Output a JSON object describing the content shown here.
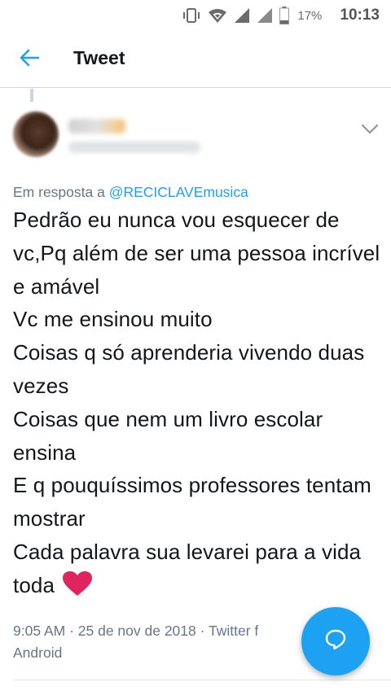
{
  "status_bar": {
    "battery_percent": "17%",
    "time": "10:13",
    "icons": [
      "vibrate-icon",
      "wifi-icon",
      "signal-icon",
      "signal-icon-2",
      "battery-icon"
    ]
  },
  "app_bar": {
    "title": "Tweet",
    "back_icon": "arrow-left-icon"
  },
  "tweet": {
    "author_name": "",
    "author_handle": "",
    "reply_prefix": "Em resposta a ",
    "reply_to": "@RECICLAVEmusica",
    "text": "Pedrão eu nunca vou esquecer de vc,Pq além de ser uma pessoa incrível e amável\nVc me ensinou muito\nCoisas q só aprenderia vivendo duas vezes\nCoisas que nem um livro escolar ensina\nE q pouquíssimos professores tentam mostrar\nCada palavra sua levarei para a vida toda ",
    "emoji": "heart-emoji",
    "meta_line1": "9:05 AM · 25 de nov de 2018 · Twitter f",
    "meta_line2": "Android",
    "menu_icon": "chevron-down-icon"
  },
  "fab": {
    "icon": "reply-bubble-icon"
  },
  "colors": {
    "accent": "#1da1f2",
    "secondary_text": "#657786",
    "heart": "#e0245e"
  }
}
